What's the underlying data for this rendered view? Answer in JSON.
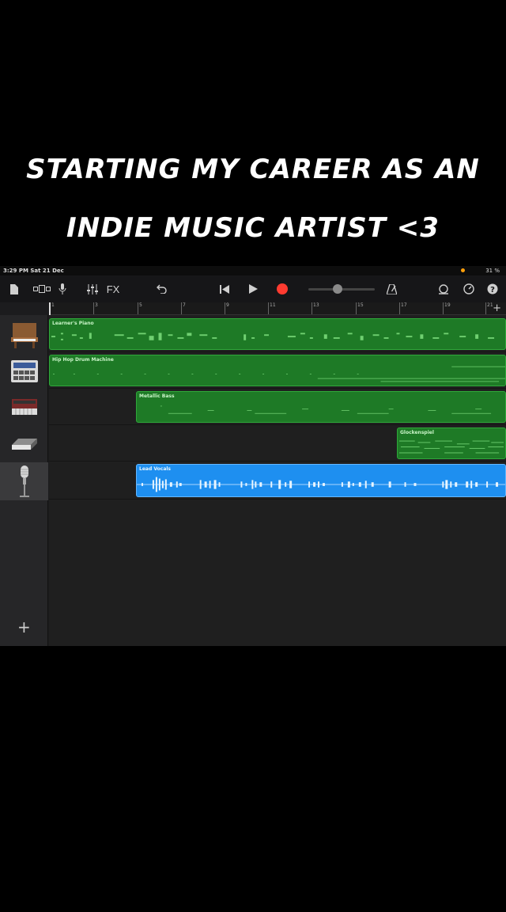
{
  "caption": {
    "line1": "STARTING MY CAREER AS AN",
    "line2": "INDIE MUSIC ARTIST <3"
  },
  "status_bar": {
    "time": "3:29 PM  Sat 21 Dec",
    "battery": "31 %"
  },
  "toolbar": {
    "fx_label": "FX",
    "icons": [
      "document-icon",
      "view-toggle-icon",
      "microphone-icon",
      "mixer-icon",
      "undo-icon",
      "rewind-icon",
      "play-icon",
      "record-icon",
      "metronome-icon",
      "loop-icon",
      "settings-icon",
      "help-icon"
    ],
    "colors": {
      "record": "#ff3b30"
    }
  },
  "ruler": {
    "bars": [
      "1",
      "3",
      "5",
      "7",
      "9",
      "11",
      "13",
      "15",
      "17",
      "19",
      "21"
    ]
  },
  "tracks": [
    {
      "name": "Learner's Piano",
      "instrument_icon": "piano-icon",
      "region_label": "Learner's Piano",
      "type": "midi",
      "color": "#1e7a26"
    },
    {
      "name": "Hip Hop Drum Machine",
      "instrument_icon": "drum-machine-icon",
      "region_label": "Hip Hop Drum Machine",
      "type": "midi",
      "color": "#1e7a26"
    },
    {
      "name": "Metallic Bass",
      "instrument_icon": "synth-keyboard-icon",
      "region_label": "Metallic Bass",
      "type": "midi",
      "color": "#1e7a26"
    },
    {
      "name": "Glockenspiel",
      "instrument_icon": "keyboard-icon",
      "region_label": "Glockenspiel",
      "type": "midi",
      "color": "#1e7a26"
    },
    {
      "name": "Lead Vocals",
      "instrument_icon": "condenser-mic-icon",
      "region_label": "Lead Vocals",
      "type": "audio",
      "color": "#1e8ff0"
    }
  ],
  "add_track_label": "+"
}
